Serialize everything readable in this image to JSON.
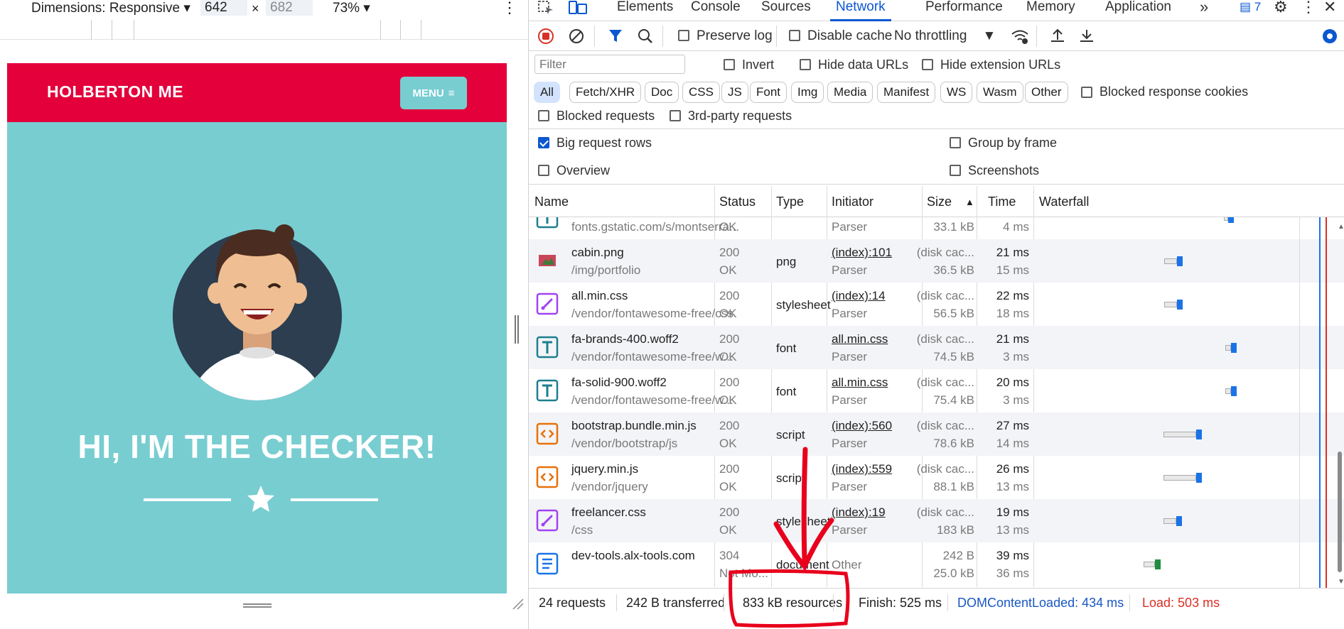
{
  "device": {
    "dimensions_label": "Dimensions: Responsive",
    "width": "642",
    "height_placeholder": "682",
    "zoom": "73%"
  },
  "site": {
    "brand": "HOLBERTON ME",
    "menu_label": "MENU",
    "headline": "HI, I'M THE CHECKER!",
    "nav_color": "#e3003b",
    "bg_color": "#78cdd1"
  },
  "devtools": {
    "tabs": [
      "Elements",
      "Console",
      "Sources",
      "Network",
      "Performance",
      "Memory",
      "Application"
    ],
    "active_tab": "Network",
    "issues_count": "7",
    "toolbar": {
      "preserve_log": "Preserve log",
      "disable_cache": "Disable cache",
      "throttling": "No throttling"
    },
    "filter": {
      "placeholder": "Filter",
      "invert": "Invert",
      "hide_data_urls": "Hide data URLs",
      "hide_extension_urls": "Hide extension URLs"
    },
    "type_chips": [
      "All",
      "Fetch/XHR",
      "Doc",
      "CSS",
      "JS",
      "Font",
      "Img",
      "Media",
      "Manifest",
      "WS",
      "Wasm",
      "Other"
    ],
    "blocked_response_cookies": "Blocked response cookies",
    "blocked_requests": "Blocked requests",
    "third_party": "3rd-party requests",
    "big_request_rows": "Big request rows",
    "group_by_frame": "Group by frame",
    "overview": "Overview",
    "screenshots": "Screenshots",
    "columns": [
      "Name",
      "Status",
      "Type",
      "Initiator",
      "Size",
      "Time",
      "Waterfall"
    ],
    "requests": [
      {
        "name": "",
        "path": "fonts.gstatic.com/s/montserra...",
        "status": "",
        "status_text": "OK",
        "type": "",
        "initiator": "",
        "initiator_sub": "Parser",
        "size": "",
        "size_sub": "33.1 kB",
        "time": "",
        "time_sub": "4 ms",
        "icon": "font-icon"
      },
      {
        "name": "cabin.png",
        "path": "/img/portfolio",
        "status": "200",
        "status_text": "OK",
        "type": "png",
        "initiator": "(index):101",
        "initiator_sub": "Parser",
        "size": "(disk cac...",
        "size_sub": "36.5 kB",
        "time": "21 ms",
        "time_sub": "15 ms",
        "icon": "image-icon"
      },
      {
        "name": "all.min.css",
        "path": "/vendor/fontawesome-free/css",
        "status": "200",
        "status_text": "OK",
        "type": "stylesheet",
        "initiator": "(index):14",
        "initiator_sub": "Parser",
        "size": "(disk cac...",
        "size_sub": "56.5 kB",
        "time": "22 ms",
        "time_sub": "18 ms",
        "icon": "stylesheet-icon"
      },
      {
        "name": "fa-brands-400.woff2",
        "path": "/vendor/fontawesome-free/w...",
        "status": "200",
        "status_text": "OK",
        "type": "font",
        "initiator": "all.min.css",
        "initiator_sub": "Parser",
        "size": "(disk cac...",
        "size_sub": "74.5 kB",
        "time": "21 ms",
        "time_sub": "3 ms",
        "icon": "font-icon"
      },
      {
        "name": "fa-solid-900.woff2",
        "path": "/vendor/fontawesome-free/w...",
        "status": "200",
        "status_text": "OK",
        "type": "font",
        "initiator": "all.min.css",
        "initiator_sub": "Parser",
        "size": "(disk cac...",
        "size_sub": "75.4 kB",
        "time": "20 ms",
        "time_sub": "3 ms",
        "icon": "font-icon"
      },
      {
        "name": "bootstrap.bundle.min.js",
        "path": "/vendor/bootstrap/js",
        "status": "200",
        "status_text": "OK",
        "type": "script",
        "initiator": "(index):560",
        "initiator_sub": "Parser",
        "size": "(disk cac...",
        "size_sub": "78.6 kB",
        "time": "27 ms",
        "time_sub": "14 ms",
        "icon": "script-icon"
      },
      {
        "name": "jquery.min.js",
        "path": "/vendor/jquery",
        "status": "200",
        "status_text": "OK",
        "type": "script",
        "initiator": "(index):559",
        "initiator_sub": "Parser",
        "size": "(disk cac...",
        "size_sub": "88.1 kB",
        "time": "26 ms",
        "time_sub": "13 ms",
        "icon": "script-icon"
      },
      {
        "name": "freelancer.css",
        "path": "/css",
        "status": "200",
        "status_text": "OK",
        "type": "stylesheet",
        "initiator": "(index):19",
        "initiator_sub": "Parser",
        "size": "(disk cac...",
        "size_sub": "183 kB",
        "time": "19 ms",
        "time_sub": "13 ms",
        "icon": "stylesheet-icon"
      },
      {
        "name": "dev-tools.alx-tools.com",
        "path": "",
        "status": "304",
        "status_text": "Not Mo...",
        "type": "document",
        "initiator": "Other",
        "initiator_sub": "",
        "size": "242 B",
        "size_sub": "25.0 kB",
        "time": "39 ms",
        "time_sub": "36 ms",
        "icon": "document-icon"
      }
    ],
    "status_bar": {
      "requests": "24 requests",
      "transferred": "242 B transferred",
      "resources": "833 kB resources",
      "finish": "Finish: 525 ms",
      "dom_content_loaded": "DOMContentLoaded: 434 ms",
      "load": "Load: 503 ms"
    }
  },
  "colors": {
    "accent": "#0b57d0",
    "record_red": "#d93025",
    "annotation_red": "#e8001c"
  }
}
